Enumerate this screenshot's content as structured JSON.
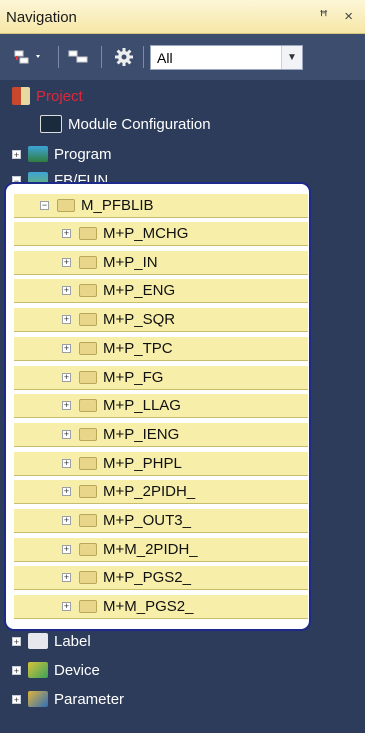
{
  "titlebar": {
    "title": "Navigation",
    "controls": "ꟸ ×"
  },
  "toolbar": {
    "filter_value": "All"
  },
  "tree": {
    "project": "Project",
    "module_configuration": "Module Configuration",
    "program": "Program",
    "fbfun": "FB/FUN",
    "library": "M_PFBLIB",
    "lib_items": [
      "M+P_MCHG",
      "M+P_IN",
      "M+P_ENG",
      "M+P_SQR",
      "M+P_TPC",
      "M+P_FG",
      "M+P_LLAG",
      "M+P_IENG",
      "M+P_PHPL",
      "M+P_2PIDH_",
      "M+P_OUT3_",
      "M+M_2PIDH_",
      "M+P_PGS2_",
      "M+M_PGS2_"
    ],
    "label": "Label",
    "device": "Device",
    "parameter": "Parameter"
  }
}
